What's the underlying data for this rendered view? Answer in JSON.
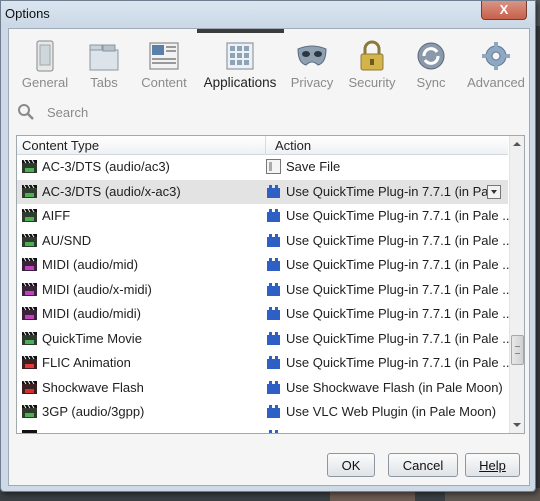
{
  "window": {
    "title": "Options",
    "close_glyph": "X"
  },
  "toolbar": {
    "items": [
      {
        "label": "General",
        "icon": "general-icon"
      },
      {
        "label": "Tabs",
        "icon": "tabs-icon"
      },
      {
        "label": "Content",
        "icon": "content-icon"
      },
      {
        "label": "Applications",
        "icon": "applications-icon",
        "selected": true
      },
      {
        "label": "Privacy",
        "icon": "privacy-mask-icon"
      },
      {
        "label": "Security",
        "icon": "lock-icon"
      },
      {
        "label": "Sync",
        "icon": "sync-icon"
      },
      {
        "label": "Advanced",
        "icon": "gear-icon"
      }
    ]
  },
  "search": {
    "placeholder": "Search"
  },
  "table": {
    "headers": {
      "content_type": "Content Type",
      "action": "Action"
    },
    "rows": [
      {
        "type": "AC-3/DTS (audio/ac3)",
        "action": "Save File",
        "type_icon": "movie-clapper-icon",
        "action_icon": "save-file-icon"
      },
      {
        "type": "AC-3/DTS (audio/x-ac3)",
        "action": "Use QuickTime Plug-in 7.7.1 (in Pa...",
        "type_icon": "movie-clapper-icon",
        "action_icon": "plugin-lego-icon",
        "selected": true
      },
      {
        "type": "AIFF",
        "action": "Use QuickTime Plug-in 7.7.1 (in Pale ...",
        "type_icon": "movie-clapper-icon",
        "action_icon": "plugin-lego-icon"
      },
      {
        "type": "AU/SND",
        "action": "Use QuickTime Plug-in 7.7.1 (in Pale ...",
        "type_icon": "movie-clapper-icon",
        "action_icon": "plugin-lego-icon"
      },
      {
        "type": "MIDI (audio/mid)",
        "action": "Use QuickTime Plug-in 7.7.1 (in Pale ...",
        "type_icon": "midi-icon",
        "action_icon": "plugin-lego-icon"
      },
      {
        "type": "MIDI (audio/x-midi)",
        "action": "Use QuickTime Plug-in 7.7.1 (in Pale ...",
        "type_icon": "midi-icon",
        "action_icon": "plugin-lego-icon"
      },
      {
        "type": "MIDI (audio/midi)",
        "action": "Use QuickTime Plug-in 7.7.1 (in Pale ...",
        "type_icon": "midi-icon",
        "action_icon": "plugin-lego-icon"
      },
      {
        "type": "QuickTime Movie",
        "action": "Use QuickTime Plug-in 7.7.1 (in Pale ...",
        "type_icon": "movie-clapper-icon",
        "action_icon": "plugin-lego-icon"
      },
      {
        "type": "FLIC Animation",
        "action": "Use QuickTime Plug-in 7.7.1 (in Pale ...",
        "type_icon": "flic-icon",
        "action_icon": "plugin-lego-icon"
      },
      {
        "type": "Shockwave Flash",
        "action": "Use Shockwave Flash (in Pale Moon)",
        "type_icon": "flash-icon",
        "action_icon": "plugin-lego-icon"
      },
      {
        "type": "3GP (audio/3gpp)",
        "action": "Use VLC Web Plugin (in Pale Moon)",
        "type_icon": "movie-clapper-icon",
        "action_icon": "plugin-lego-icon"
      }
    ]
  },
  "buttons": {
    "ok": "OK",
    "cancel": "Cancel",
    "help": "Help"
  }
}
